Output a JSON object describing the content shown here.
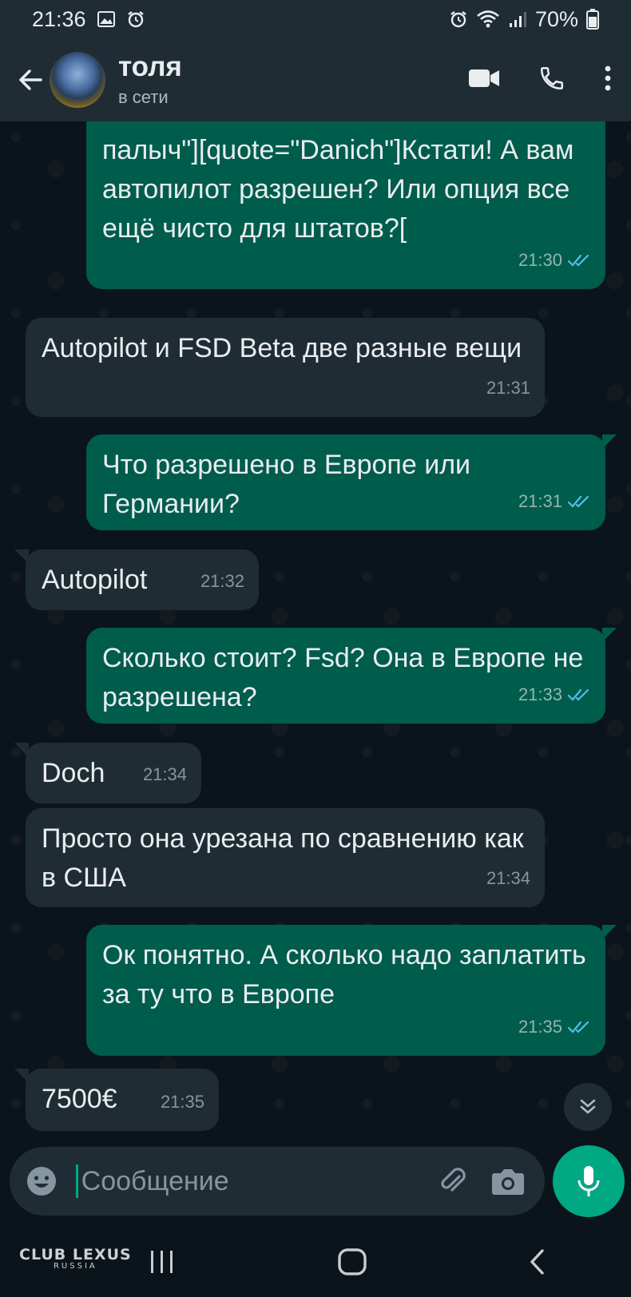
{
  "status_bar": {
    "time": "21:36",
    "battery": "70%"
  },
  "header": {
    "contact_name": "толя",
    "contact_status": "в сети"
  },
  "messages": [
    {
      "direction": "out",
      "text": "палыч\"][quote=\"Danich\"]Кстати! А вам автопилот разрешен? Или опция все ещё чисто для штатов?[",
      "time": "21:30",
      "read": true
    },
    {
      "direction": "in",
      "text": "Autopilot и FSD Beta две разные вещи",
      "time": "21:31"
    },
    {
      "direction": "out",
      "text": "Что разрешено в Европе или Германии?",
      "time": "21:31",
      "read": true
    },
    {
      "direction": "in",
      "text": "Autopilot",
      "time": "21:32"
    },
    {
      "direction": "out",
      "text": "Сколько стоит? Fsd? Она в Европе не разрешена?",
      "time": "21:33",
      "read": true
    },
    {
      "direction": "in",
      "text": "Doch",
      "time": "21:34"
    },
    {
      "direction": "in",
      "text": "Просто она урезана по сравнению как в США",
      "time": "21:34"
    },
    {
      "direction": "out",
      "text": "Ок понятно. А сколько надо заплатить за ту что в Европе",
      "time": "21:35",
      "read": true
    },
    {
      "direction": "in",
      "text": "7500€",
      "time": "21:35"
    }
  ],
  "composer": {
    "placeholder": "Сообщение"
  },
  "watermark": {
    "line1": "CLUB LEXUS",
    "line2": "RUSSIA"
  },
  "colors": {
    "outgoing_bubble": "#005c4b",
    "incoming_bubble": "#202c33",
    "accent": "#00a884",
    "read_ticks": "#53bdeb"
  }
}
